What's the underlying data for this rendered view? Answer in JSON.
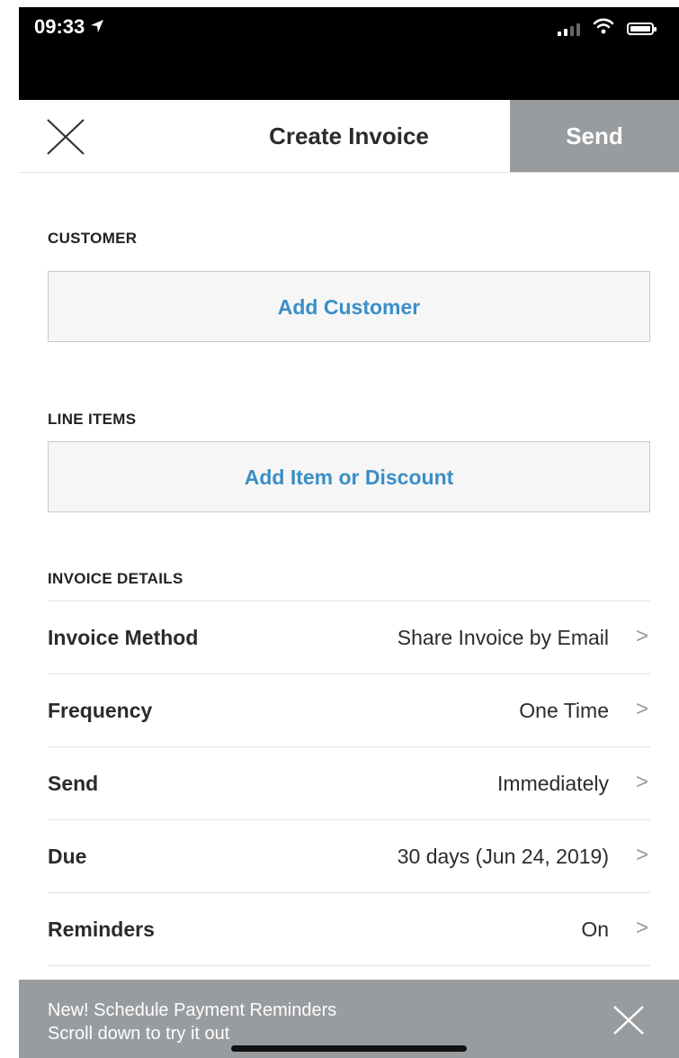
{
  "status_bar": {
    "time": "09:33",
    "location_icon": "location-arrow-icon",
    "signal_icon": "cellular-signal-icon",
    "wifi_icon": "wifi-icon",
    "battery_icon": "battery-icon"
  },
  "nav": {
    "close_icon": "close-icon",
    "title": "Create Invoice",
    "send_label": "Send"
  },
  "customer": {
    "label": "CUSTOMER",
    "button": "Add Customer"
  },
  "line_items": {
    "label": "LINE ITEMS",
    "button": "Add Item or Discount"
  },
  "invoice_details": {
    "label": "INVOICE DETAILS",
    "rows": [
      {
        "label": "Invoice Method",
        "value": "Share Invoice by Email"
      },
      {
        "label": "Frequency",
        "value": "One Time"
      },
      {
        "label": "Send",
        "value": "Immediately"
      },
      {
        "label": "Due",
        "value": "30 days (Jun 24, 2019)"
      },
      {
        "label": "Reminders",
        "value": "On"
      }
    ],
    "chevron": ">"
  },
  "banner": {
    "line1": "New! Schedule Payment Reminders",
    "line2": "Scroll down to try it out",
    "close_icon": "close-icon"
  },
  "colors": {
    "accent": "#3a8fc7",
    "send_bg": "#999c9f",
    "banner_bg": "#999c9f"
  }
}
